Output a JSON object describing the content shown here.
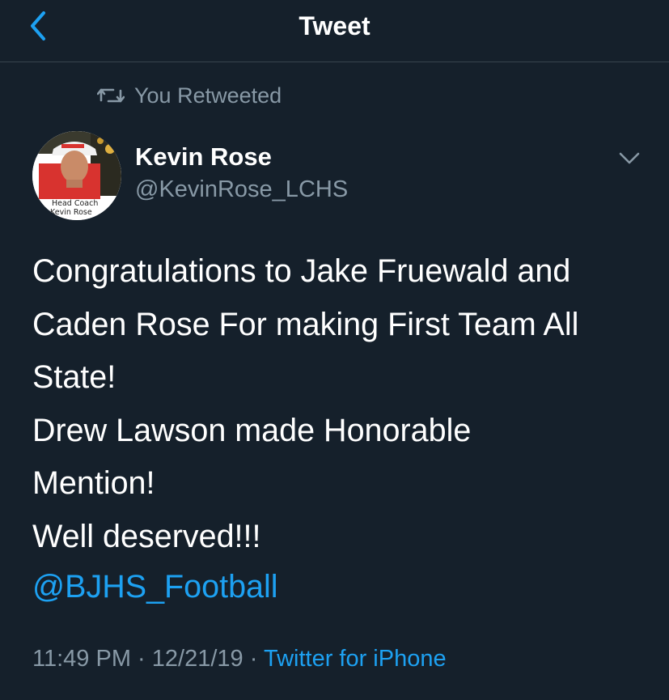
{
  "nav": {
    "title": "Tweet",
    "back_icon": "chevron-left-icon"
  },
  "retweet": {
    "icon": "retweet-icon",
    "label": "You Retweeted"
  },
  "author": {
    "name": "Kevin Rose",
    "handle": "@KevinRose_LCHS",
    "avatar_caption_line1": "Head Coach",
    "avatar_caption_line2": "Kevin Rose"
  },
  "tweet": {
    "text": "Congratulations to Jake Fruewald and\nCaden Rose For making First Team All\nState!\nDrew Lawson made Honorable\nMention!\nWell deserved!!!",
    "mention": "@BJHS_Football",
    "time": "11:49 PM",
    "date": "12/21/19",
    "separator": "·",
    "source": "Twitter for iPhone"
  },
  "colors": {
    "background": "#15202b",
    "accent": "#1da1f2",
    "secondary_text": "#8899a6",
    "divider": "#38444d"
  }
}
